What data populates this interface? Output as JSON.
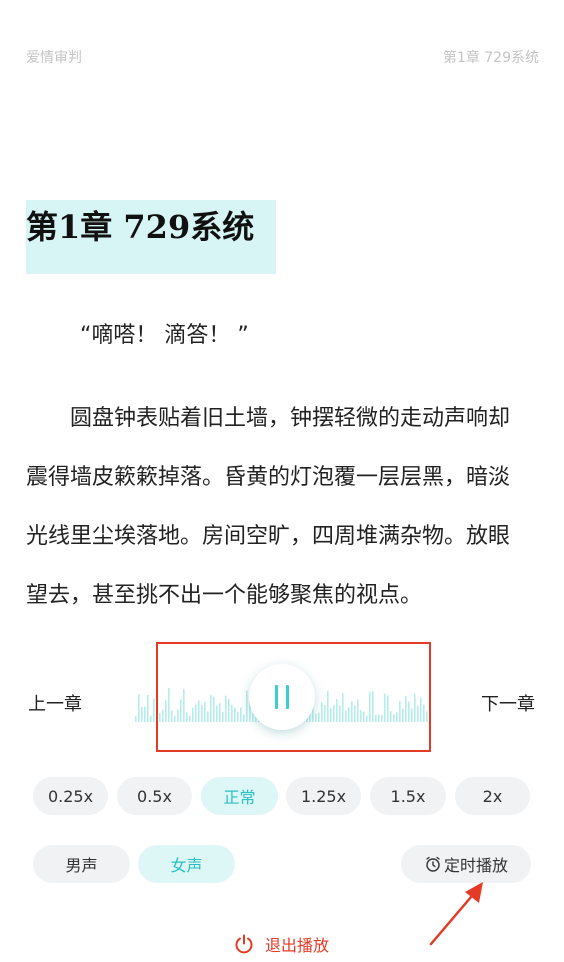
{
  "header": {
    "book_title": "爱情审判",
    "chapter_label": "第1章 729系统"
  },
  "content": {
    "chapter_title": "第1章 729系统",
    "lines": [
      "“嘀嗒！ 滴答！ ”",
      "圆盘钟表贴着旧土墙，钟摆轻微的走动声响却",
      "震得墙皮簌簌掉落。昏黄的灯泡覆一层层黑，暗淡",
      "光线里尘埃落地。房间空旷，四周堆满杂物。放眼",
      "望去，甚至挑不出一个能够聚焦的视点。"
    ]
  },
  "player": {
    "prev_label": "上一章",
    "next_label": "下一章",
    "state": "playing",
    "speeds": [
      "0.25x",
      "0.5x",
      "正常",
      "1.25x",
      "1.5x",
      "2x"
    ],
    "selected_speed": "正常",
    "voices": [
      "男声",
      "女声"
    ],
    "selected_voice": "女声",
    "timer_label": "定时播放",
    "exit_label": "退出播放"
  },
  "colors": {
    "accent": "#3ccfd0",
    "accent_bg": "#ddf7f6",
    "highlight": "#d6f5f4",
    "annotation_red": "#e53a25"
  },
  "icons": {
    "timer": "alarm-clock-icon",
    "exit": "power-icon",
    "play_state": "pause-icon"
  }
}
